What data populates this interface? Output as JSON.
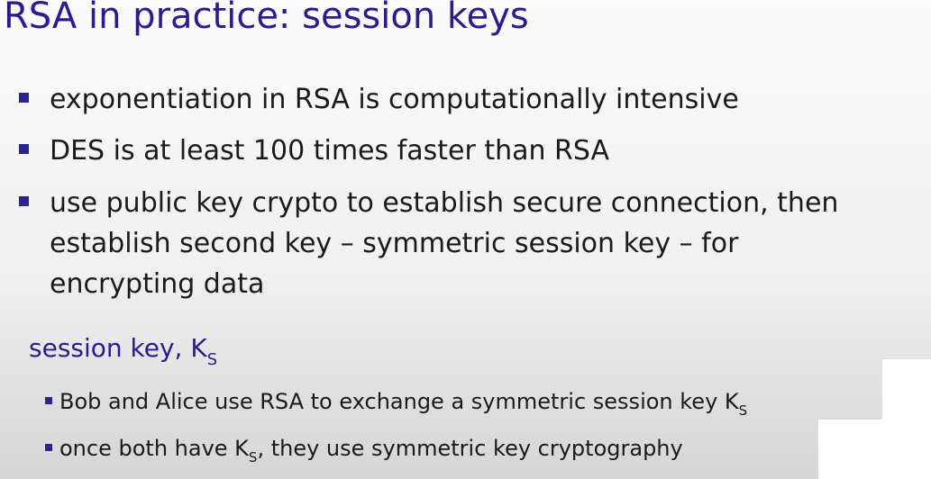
{
  "slide": {
    "title": "RSA in practice: session keys",
    "bullets": [
      "exponentiation in RSA is computationally intensive",
      "DES is at least 100 times faster than RSA"
    ],
    "bullet3": {
      "line1": "use public key crypto to establish secure connection, then",
      "line2": "establish second key – symmetric session key – for",
      "line3": "encrypting data"
    },
    "section": {
      "heading_text": "session key, K",
      "heading_sub": "S",
      "items": [
        {
          "text": "Bob and Alice use RSA to exchange a symmetric session key K",
          "sub": "S",
          "after": ""
        },
        {
          "text": "once both have K",
          "sub": "S",
          "after": ", they use symmetric key cryptography"
        }
      ]
    }
  },
  "colors": {
    "title": "#2e1a8f",
    "section_heading": "#2d1b8f",
    "bullet_marker": "#2b238f",
    "body_text": "#1a1a1a"
  }
}
